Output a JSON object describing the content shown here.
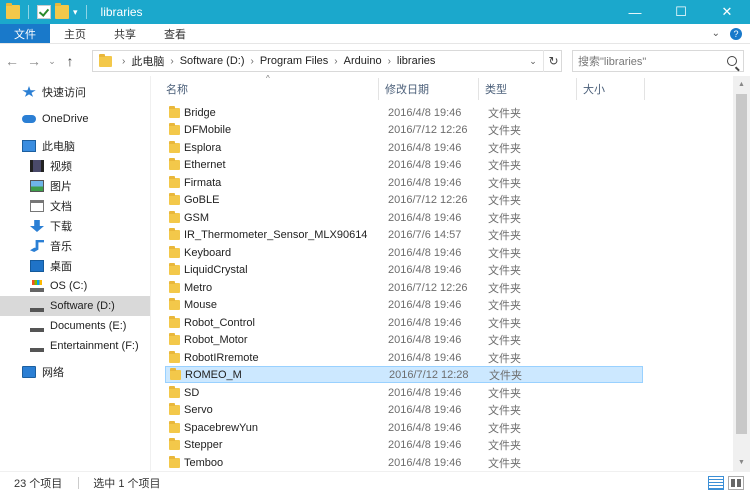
{
  "window": {
    "title": "libraries",
    "controls": {
      "minimize": "—",
      "maximize": "☐",
      "close": "✕"
    },
    "qa_dropdown": "▾"
  },
  "ribbon": {
    "tabs": [
      "文件",
      "主页",
      "共享",
      "查看"
    ],
    "expand": "⌄",
    "help": "?"
  },
  "nav": {
    "back": "←",
    "forward": "→",
    "recent": "⌄",
    "up": "↑",
    "breadcrumb": [
      "此电脑",
      "Software (D:)",
      "Program Files",
      "Arduino",
      "libraries"
    ],
    "crumb_sep": "›",
    "address_dropdown": "⌄",
    "refresh": "↻",
    "search_placeholder": "搜索\"libraries\""
  },
  "sidebar": {
    "items": [
      {
        "label": "快速访问",
        "icon": "star-icon",
        "selected": false
      },
      {
        "label": "OneDrive",
        "icon": "cloud-icon",
        "selected": false
      },
      {
        "label": "此电脑",
        "icon": "pc-icon",
        "selected": false
      },
      {
        "label": "视频",
        "icon": "video-icon",
        "selected": false
      },
      {
        "label": "图片",
        "icon": "picture-icon",
        "selected": false
      },
      {
        "label": "文档",
        "icon": "document-icon",
        "selected": false
      },
      {
        "label": "下载",
        "icon": "download-icon",
        "selected": false
      },
      {
        "label": "音乐",
        "icon": "music-icon",
        "selected": false
      },
      {
        "label": "桌面",
        "icon": "desktop-icon",
        "selected": false
      },
      {
        "label": "OS (C:)",
        "icon": "os-drive-icon",
        "selected": false
      },
      {
        "label": "Software (D:)",
        "icon": "drive-icon",
        "selected": true
      },
      {
        "label": "Documents (E:)",
        "icon": "drive-icon",
        "selected": false
      },
      {
        "label": "Entertainment (F:)",
        "icon": "drive-icon",
        "selected": false
      },
      {
        "label": "网络",
        "icon": "network-icon",
        "selected": false
      }
    ]
  },
  "columns": {
    "name": "名称",
    "date": "修改日期",
    "type": "类型",
    "size": "大小",
    "sort_arrow": "^"
  },
  "files": [
    {
      "name": "Bridge",
      "date": "2016/4/8 19:46",
      "type": "文件夹"
    },
    {
      "name": "DFMobile",
      "date": "2016/7/12 12:26",
      "type": "文件夹"
    },
    {
      "name": "Esplora",
      "date": "2016/4/8 19:46",
      "type": "文件夹"
    },
    {
      "name": "Ethernet",
      "date": "2016/4/8 19:46",
      "type": "文件夹"
    },
    {
      "name": "Firmata",
      "date": "2016/4/8 19:46",
      "type": "文件夹"
    },
    {
      "name": "GoBLE",
      "date": "2016/7/12 12:26",
      "type": "文件夹"
    },
    {
      "name": "GSM",
      "date": "2016/4/8 19:46",
      "type": "文件夹"
    },
    {
      "name": "IR_Thermometer_Sensor_MLX90614",
      "date": "2016/7/6 14:57",
      "type": "文件夹"
    },
    {
      "name": "Keyboard",
      "date": "2016/4/8 19:46",
      "type": "文件夹"
    },
    {
      "name": "LiquidCrystal",
      "date": "2016/4/8 19:46",
      "type": "文件夹"
    },
    {
      "name": "Metro",
      "date": "2016/7/12 12:26",
      "type": "文件夹"
    },
    {
      "name": "Mouse",
      "date": "2016/4/8 19:46",
      "type": "文件夹"
    },
    {
      "name": "Robot_Control",
      "date": "2016/4/8 19:46",
      "type": "文件夹"
    },
    {
      "name": "Robot_Motor",
      "date": "2016/4/8 19:46",
      "type": "文件夹"
    },
    {
      "name": "RobotIRremote",
      "date": "2016/4/8 19:46",
      "type": "文件夹"
    },
    {
      "name": "ROMEO_M",
      "date": "2016/7/12 12:28",
      "type": "文件夹",
      "selected": true
    },
    {
      "name": "SD",
      "date": "2016/4/8 19:46",
      "type": "文件夹"
    },
    {
      "name": "Servo",
      "date": "2016/4/8 19:46",
      "type": "文件夹"
    },
    {
      "name": "SpacebrewYun",
      "date": "2016/4/8 19:46",
      "type": "文件夹"
    },
    {
      "name": "Stepper",
      "date": "2016/4/8 19:46",
      "type": "文件夹"
    },
    {
      "name": "Temboo",
      "date": "2016/4/8 19:46",
      "type": "文件夹"
    }
  ],
  "scrollbar": {
    "up": "▲",
    "down": "▼"
  },
  "status": {
    "count": "23 个项目",
    "selected": "选中 1 个项目"
  },
  "colors": {
    "titlebar": "#1ba8cc",
    "file_tab": "#1979ca",
    "selection": "#cce8ff",
    "folder": "#f3c84a"
  }
}
